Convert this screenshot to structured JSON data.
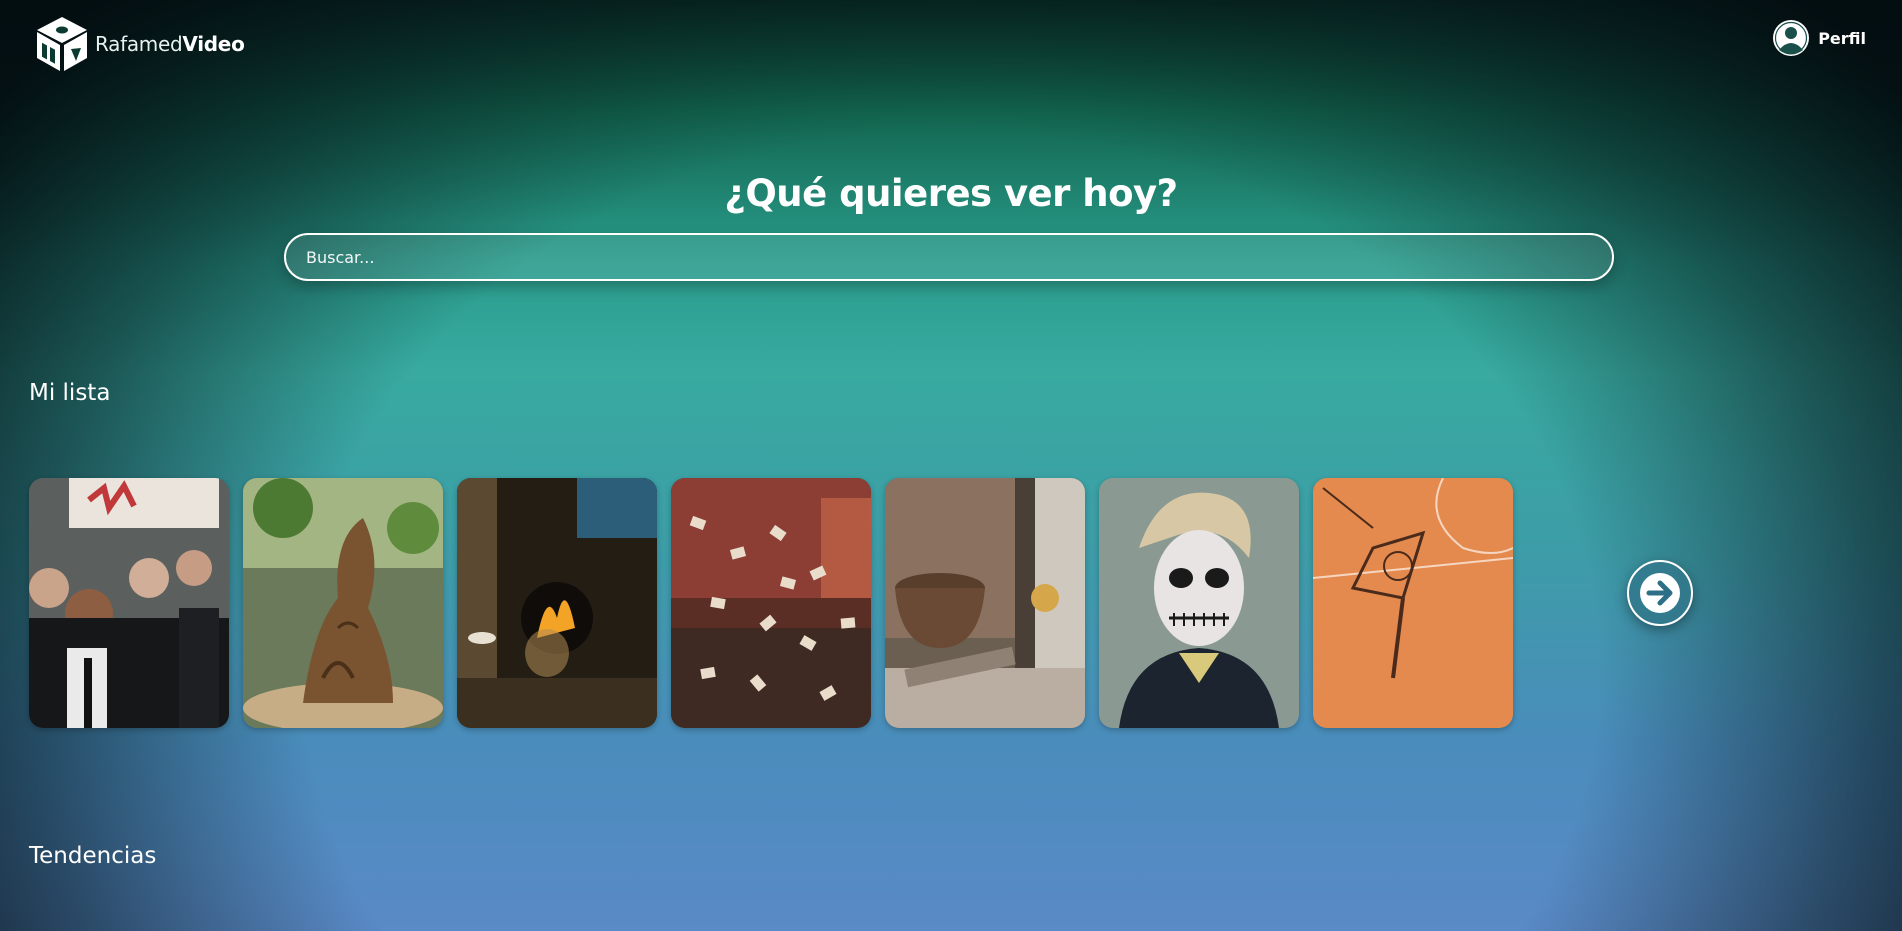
{
  "header": {
    "logo_text_light": "Rafamed",
    "logo_text_bold": "Video",
    "profile_label": "Perfil"
  },
  "hero": {
    "title": "¿Qué quieres ver hoy?"
  },
  "search": {
    "placeholder": "Buscar...",
    "value": ""
  },
  "sections": {
    "my_list": "Mi lista",
    "trending": "Tendencias"
  },
  "icons": {
    "logo": "cube-logo-icon",
    "profile": "user-avatar-icon",
    "next": "arrow-right-icon"
  },
  "colors": {
    "background_top": "#072a22",
    "background_mid": "#38aaa0",
    "background_bottom": "#5a8ac7",
    "text": "#ffffff"
  }
}
